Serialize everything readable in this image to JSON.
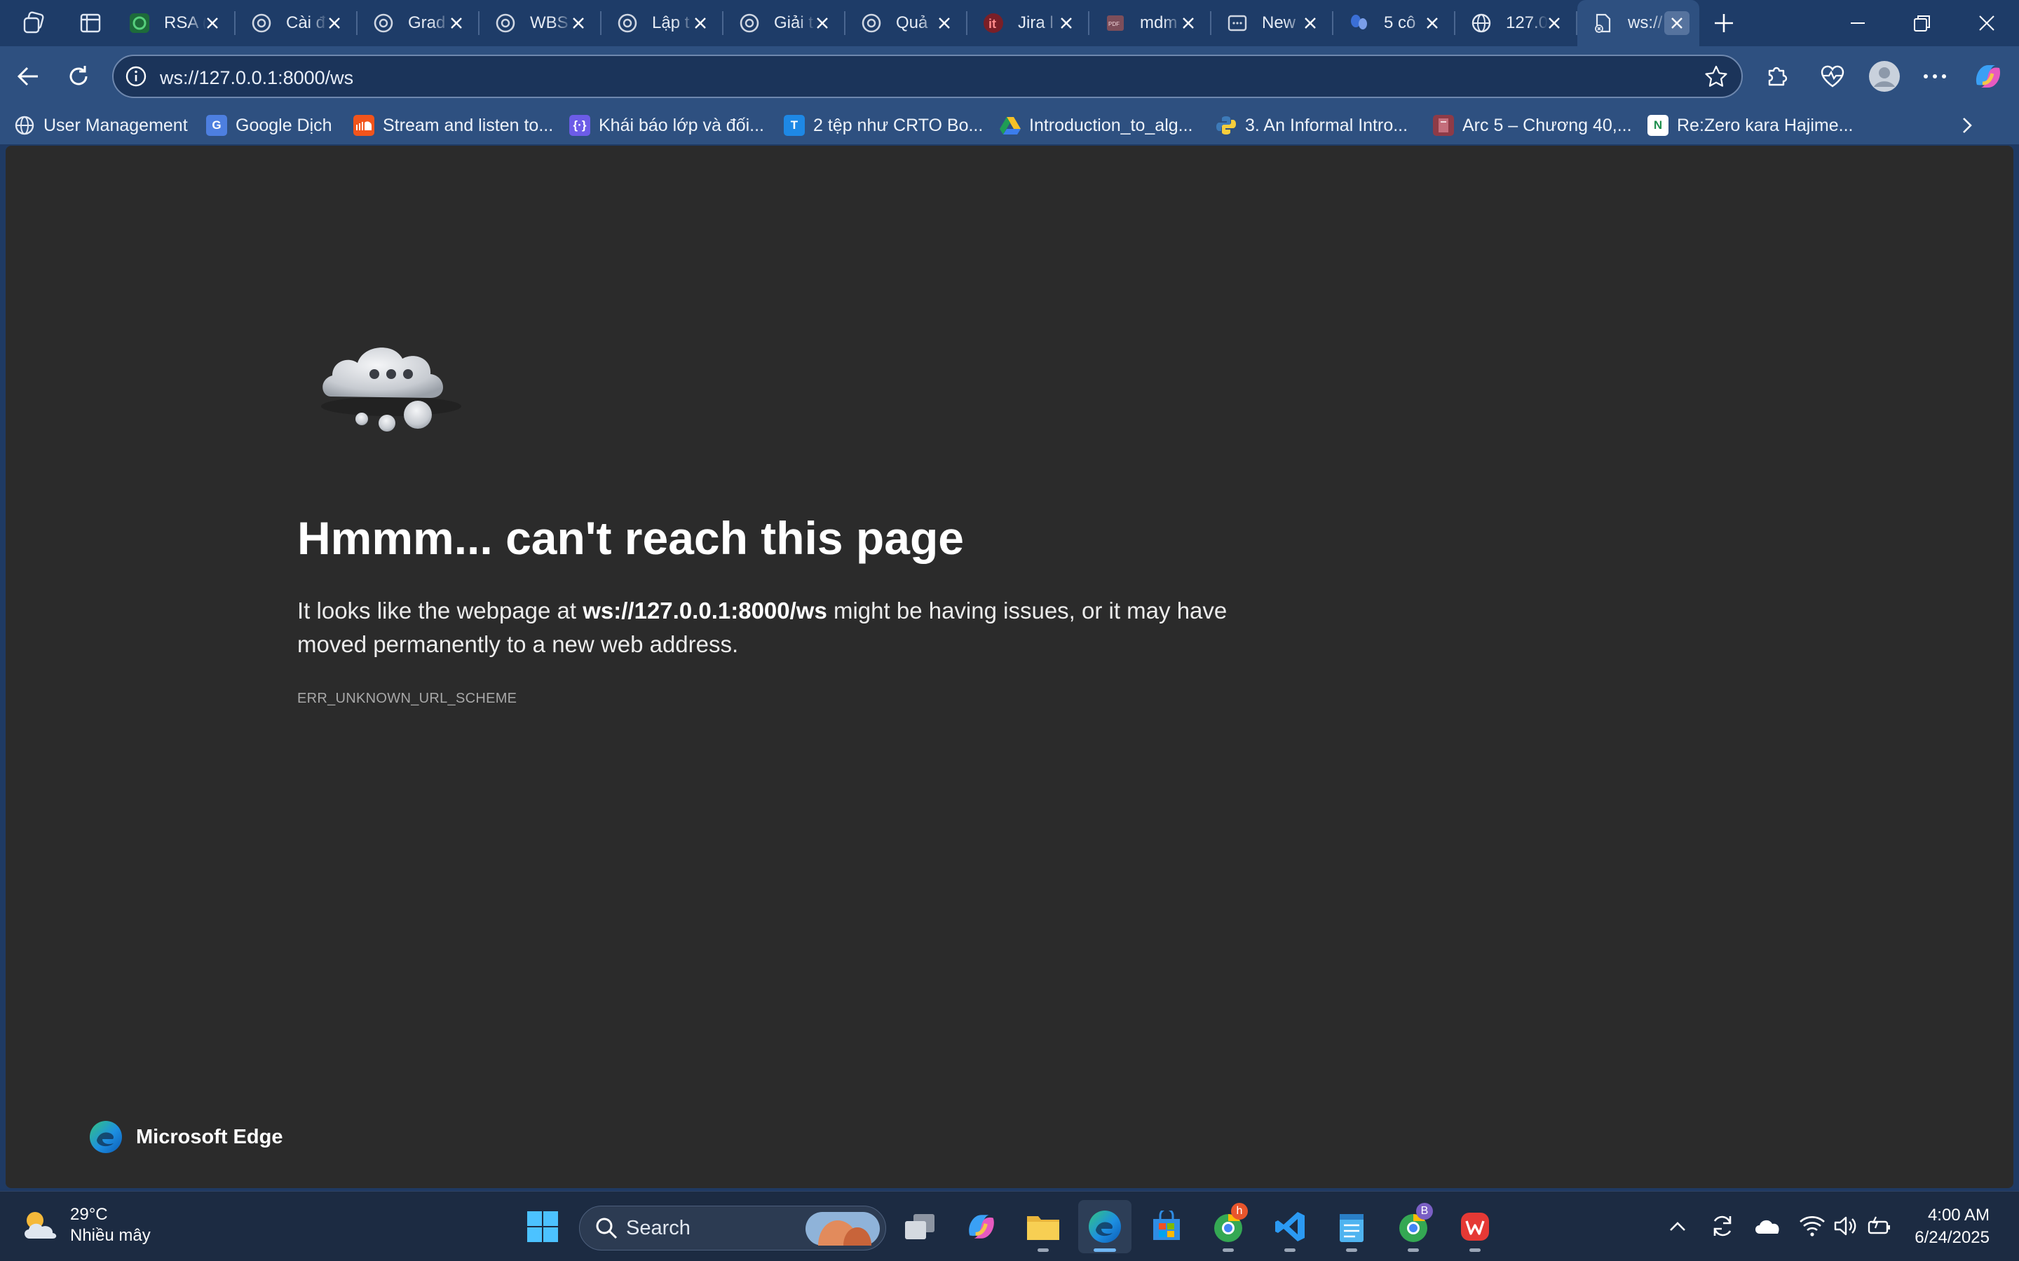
{
  "tabs": [
    {
      "title": "RSA (",
      "icon": "rsa-icon"
    },
    {
      "title": "Cài đ",
      "icon": "openai-icon"
    },
    {
      "title": "Grad",
      "icon": "openai-icon"
    },
    {
      "title": "WBS",
      "icon": "openai-icon"
    },
    {
      "title": "Lập t",
      "icon": "openai-icon"
    },
    {
      "title": "Giải t",
      "icon": "openai-icon"
    },
    {
      "title": "Quả",
      "icon": "openai-icon"
    },
    {
      "title": "Jira l",
      "icon": "itviec-icon"
    },
    {
      "title": "mdm",
      "icon": "pdf-icon"
    },
    {
      "title": "New",
      "icon": "newtab-icon"
    },
    {
      "title": "5 cô",
      "icon": "butterfly-icon"
    },
    {
      "title": "127.0",
      "icon": "globe-icon"
    },
    {
      "title": "ws://",
      "icon": "error-page-icon",
      "active": true
    }
  ],
  "address": {
    "url": "ws://127.0.0.1:8000/ws"
  },
  "bookmarks": [
    {
      "label": "User Management",
      "icon": "bookmark-icon"
    },
    {
      "label": "Google Dịch",
      "icon": "google-translate-icon"
    },
    {
      "label": "Stream and listen to...",
      "icon": "soundcloud-icon"
    },
    {
      "label": "Khái báo lớp và đối...",
      "icon": "code-icon"
    },
    {
      "label": "2 tệp như CRTO Bo...",
      "icon": "tep-icon"
    },
    {
      "label": "Introduction_to_alg...",
      "icon": "drive-icon"
    },
    {
      "label": "3. An Informal Intro...",
      "icon": "python-icon"
    },
    {
      "label": "Arc 5 – Chương 40,...",
      "icon": "book-icon"
    },
    {
      "label": "Re:Zero kara Hajime...",
      "icon": "novel-icon"
    }
  ],
  "error": {
    "title": "Hmmm... can't reach this page",
    "body_prefix": "It looks like the webpage at ",
    "body_url": "ws://127.0.0.1:8000/ws",
    "body_suffix": " might be having issues, or it may have moved permanently to a new web address.",
    "code": "ERR_UNKNOWN_URL_SCHEME"
  },
  "brand": {
    "label": "Microsoft Edge"
  },
  "taskbar": {
    "temperature": "29°C",
    "weather": "Nhiều mây",
    "search_label": "Search",
    "time": "4:00 AM",
    "date": "6/24/2025",
    "badge_h": "h",
    "badge_b": "B"
  },
  "colors": {
    "tabstrip": "#1e3c68",
    "toolbar": "#2e5080",
    "page_bg": "#2b2b2b",
    "taskbar": "#1c2b42"
  }
}
